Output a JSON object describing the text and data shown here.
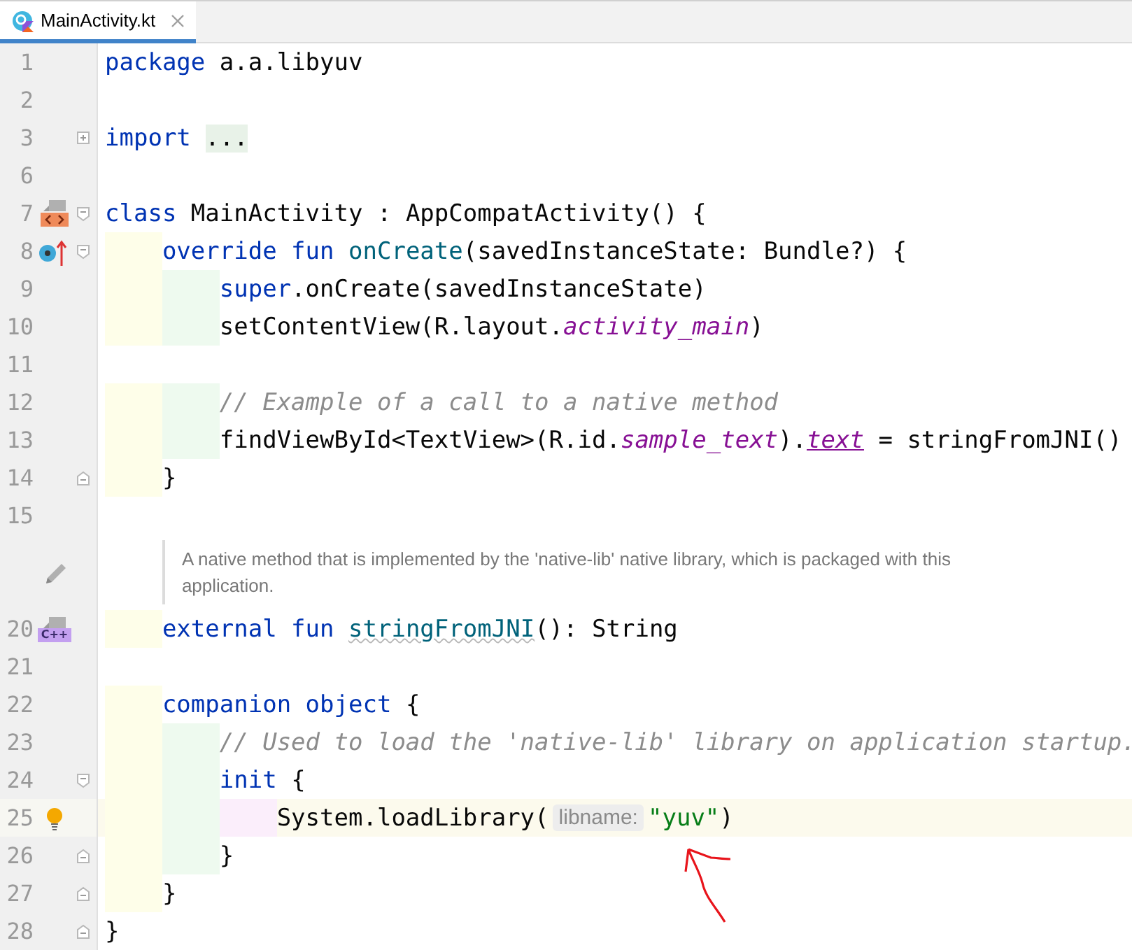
{
  "tab": {
    "label": "MainActivity.kt",
    "selected": true
  },
  "lines": [
    {
      "kind": "code",
      "number": "1",
      "current": false,
      "tokens": [
        {
          "kind": "keyword",
          "text": "package"
        },
        {
          "kind": "text",
          "text": " a.a.libyuv"
        }
      ]
    },
    {
      "kind": "code",
      "number": "2",
      "current": false
    },
    {
      "kind": "code",
      "number": "3",
      "current": false,
      "fold": {
        "kind": "collapsed"
      },
      "tokens": [
        {
          "kind": "keyword",
          "text": "import "
        },
        {
          "kind": "folded",
          "text": "..."
        }
      ]
    },
    {
      "kind": "code",
      "number": "6",
      "current": false
    },
    {
      "kind": "code",
      "number": "7",
      "current": false,
      "marker": {
        "kind": "implemented"
      },
      "fold": {
        "kind": "open"
      },
      "tokens": [
        {
          "kind": "keyword",
          "text": "class "
        },
        {
          "kind": "text",
          "text": "MainActivity : AppCompatActivity() {"
        }
      ],
      "children": [
        {
          "kind": "code",
          "number": "8",
          "current": false,
          "marker": {
            "kind": "override"
          },
          "fold": {
            "kind": "open"
          },
          "tokens": [
            {
              "kind": "keyword",
              "text": "override fun "
            },
            {
              "kind": "decl",
              "text": "onCreate"
            },
            {
              "kind": "text",
              "text": "(savedInstanceState: Bundle?) {"
            }
          ],
          "children": [
            {
              "kind": "code",
              "number": "9",
              "current": false,
              "tokens": [
                {
                  "kind": "keyword",
                  "text": "super"
                },
                {
                  "kind": "text",
                  "text": ".onCreate(savedInstanceState)"
                }
              ]
            },
            {
              "kind": "code",
              "number": "10",
              "current": false,
              "tokens": [
                {
                  "kind": "text",
                  "text": "setContentView(R.layout."
                },
                {
                  "kind": "field",
                  "text": "activity_main"
                },
                {
                  "kind": "text",
                  "text": ")"
                }
              ]
            },
            {
              "kind": "code",
              "number": "11",
              "current": false
            },
            {
              "kind": "code",
              "number": "12",
              "current": false,
              "tokens": [
                {
                  "kind": "comment",
                  "text": "// Example of a call to a native method"
                }
              ]
            },
            {
              "kind": "code",
              "number": "13",
              "current": false,
              "tokens": [
                {
                  "kind": "text",
                  "text": "findViewById<TextView>(R.id."
                },
                {
                  "kind": "field",
                  "text": "sample_text"
                },
                {
                  "kind": "text",
                  "text": ")."
                },
                {
                  "kind": "synthetic",
                  "text": "text"
                },
                {
                  "kind": "text",
                  "text": " = stringFromJNI()"
                }
              ]
            }
          ]
        },
        {
          "kind": "code",
          "number": "14",
          "current": false,
          "fold": {
            "kind": "end"
          },
          "tokens": [
            {
              "kind": "text",
              "text": "}"
            }
          ]
        },
        {
          "kind": "code",
          "number": "15",
          "current": false
        },
        {
          "kind": "doc",
          "marker": {
            "kind": "pencil"
          },
          "text": "A native method that is implemented by the 'native-lib' native library, which is packaged with this application."
        },
        {
          "kind": "code",
          "number": "20",
          "current": false,
          "marker": {
            "kind": "cpp",
            "label": "C++"
          },
          "tokens": [
            {
              "kind": "keyword",
              "text": "external fun "
            },
            {
              "kind": "decl-warn",
              "text": "stringFromJNI"
            },
            {
              "kind": "text",
              "text": "(): String"
            }
          ]
        },
        {
          "kind": "code",
          "number": "21",
          "current": false
        },
        {
          "kind": "code",
          "number": "22",
          "current": false,
          "tokens": [
            {
              "kind": "keyword",
              "text": "companion object"
            },
            {
              "kind": "text",
              "text": " {"
            }
          ],
          "children": [
            {
              "kind": "code",
              "number": "23",
              "current": false,
              "tokens": [
                {
                  "kind": "comment",
                  "text": "// Used to load the 'native-lib' library on application startup."
                }
              ]
            },
            {
              "kind": "code",
              "number": "24",
              "current": false,
              "fold": {
                "kind": "open"
              },
              "tokens": [
                {
                  "kind": "keyword",
                  "text": "init"
                },
                {
                  "kind": "text",
                  "text": " {"
                }
              ],
              "children": [
                {
                  "kind": "code",
                  "number": "25",
                  "current": true,
                  "marker": {
                    "kind": "bulb"
                  },
                  "tokens": [
                    {
                      "kind": "text",
                      "text": "System.loadLibrary("
                    },
                    {
                      "kind": "hint",
                      "text": "libname:"
                    },
                    {
                      "kind": "string",
                      "text": "\"yuv\""
                    },
                    {
                      "kind": "text",
                      "text": ")"
                    }
                  ]
                }
              ]
            },
            {
              "kind": "code",
              "number": "26",
              "current": false,
              "fold": {
                "kind": "end"
              },
              "tokens": [
                {
                  "kind": "text",
                  "text": "}"
                }
              ]
            }
          ]
        },
        {
          "kind": "code",
          "number": "27",
          "current": false,
          "fold": {
            "kind": "end"
          },
          "tokens": [
            {
              "kind": "text",
              "text": "}"
            }
          ]
        }
      ]
    },
    {
      "kind": "code",
      "number": "28",
      "current": false,
      "fold": {
        "kind": "end"
      },
      "tokens": [
        {
          "kind": "text",
          "text": "}"
        }
      ]
    }
  ]
}
